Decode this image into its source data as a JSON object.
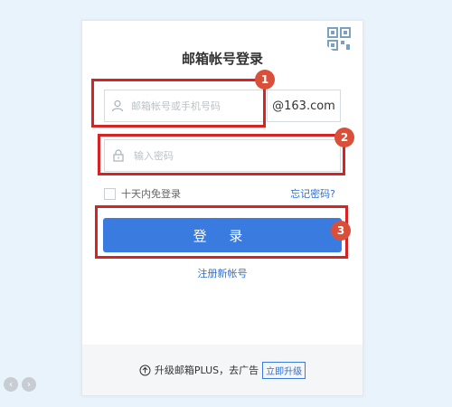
{
  "login": {
    "title": "邮箱帐号登录",
    "username_placeholder": "邮箱帐号或手机号码",
    "domain": "@163.com",
    "password_placeholder": "输入密码",
    "remember_label": "十天内免登录",
    "forgot_label": "忘记密码?",
    "login_button": "登 录",
    "register_link": "注册新帐号"
  },
  "footer": {
    "upgrade_text": "升级邮箱PLUS，去广告",
    "upgrade_button": "立即升级"
  },
  "annotations": [
    "1",
    "2",
    "3"
  ],
  "colors": {
    "primary": "#3a7be0",
    "link": "#2d6fd8",
    "annotation": "#d62323",
    "background": "#e9f3fb"
  }
}
